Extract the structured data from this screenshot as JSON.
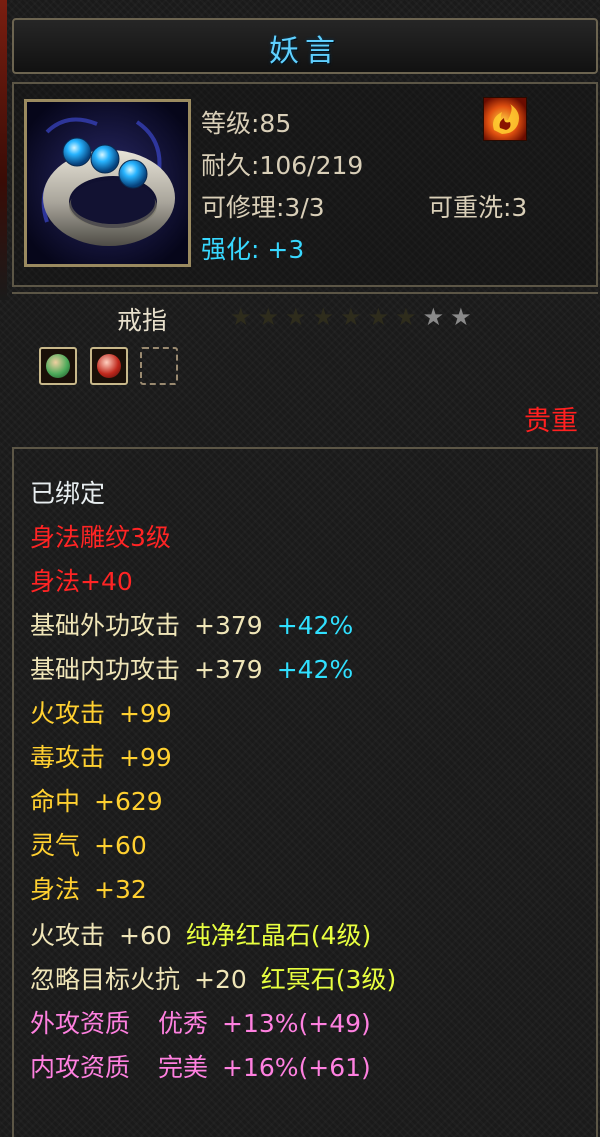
{
  "item": {
    "name": "妖言",
    "stats": {
      "level": "等级:85",
      "durability": "耐久:106/219",
      "repairable": "可修理:3/3",
      "rewashable": "可重洗:3",
      "enhance": "强化: +3"
    },
    "slot_type": "戒指",
    "stars": {
      "filled": 7,
      "total": 9,
      "dim_color": "#2e2c1c",
      "lit_color": "#8a8a8a"
    },
    "gems": [
      {
        "state": "filled",
        "color": "#4caa5a",
        "icon": "green-gem-icon"
      },
      {
        "state": "filled",
        "color": "#c0281c",
        "icon": "red-gem-icon"
      },
      {
        "state": "empty",
        "icon": "empty-socket"
      }
    ],
    "rarity": "贵重",
    "details": {
      "bound": "已绑定",
      "engraving": "身法雕纹3级",
      "engraving_bonus": "身法+40",
      "ext_attack": {
        "label": "基础外功攻击",
        "value": "+379",
        "percent": "+42%"
      },
      "int_attack": {
        "label": "基础内功攻击",
        "value": "+379",
        "percent": "+42%"
      },
      "fire_attack": {
        "label": "火攻击",
        "value": "+99"
      },
      "poison_attack": {
        "label": "毒攻击",
        "value": "+99"
      },
      "accuracy": {
        "label": "命中",
        "value": "+629"
      },
      "spirit": {
        "label": "灵气",
        "value": "+60"
      },
      "agility": {
        "label": "身法",
        "value": "+32"
      },
      "gem1": {
        "label": "火攻击",
        "value": "+60",
        "gem": "纯净红晶石(4级)"
      },
      "gem2": {
        "label": "忽略目标火抗",
        "value": "+20",
        "gem": "红冥石(3级)"
      },
      "ext_quality": {
        "label": "外攻资质",
        "grade": "优秀",
        "value": "+13%(+49)"
      },
      "int_quality": {
        "label": "内攻资质",
        "grade": "完美",
        "value": "+16%(+61)"
      }
    }
  }
}
